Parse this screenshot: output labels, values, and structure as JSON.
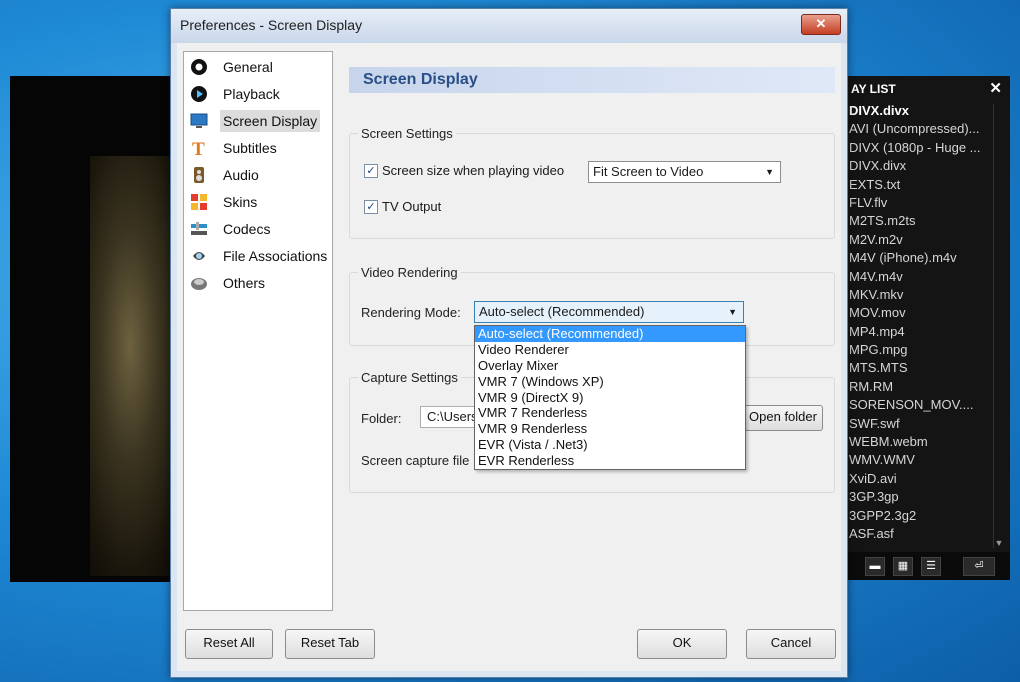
{
  "window": {
    "title": "Preferences - Screen Display",
    "close_glyph": "✕"
  },
  "nav": {
    "items": [
      {
        "label": "General",
        "icon": "general-icon"
      },
      {
        "label": "Playback",
        "icon": "playback-icon"
      },
      {
        "label": "Screen Display",
        "icon": "monitor-icon",
        "selected": true
      },
      {
        "label": "Subtitles",
        "icon": "text-t-icon"
      },
      {
        "label": "Audio",
        "icon": "speaker-icon"
      },
      {
        "label": "Skins",
        "icon": "skins-icon"
      },
      {
        "label": "Codecs",
        "icon": "codecs-icon"
      },
      {
        "label": "File Associations",
        "icon": "file-associations-icon"
      },
      {
        "label": "Others",
        "icon": "others-icon"
      }
    ]
  },
  "panel": {
    "title": "Screen Display",
    "screen_settings": {
      "title": "Screen Settings",
      "screen_size_checkbox": {
        "label": "Screen size when playing video",
        "checked": true
      },
      "screen_size_select": "Fit Screen to Video",
      "tv_output_checkbox": {
        "label": "TV Output",
        "checked": true
      }
    },
    "video_rendering": {
      "title": "Video Rendering",
      "mode_label": "Rendering Mode:",
      "mode_value": "Auto-select (Recommended)",
      "options": [
        "Auto-select (Recommended)",
        "Video Renderer",
        "Overlay Mixer",
        "VMR 7 (Windows XP)",
        "VMR 9 (DirectX 9)",
        "VMR 7 Renderless",
        "VMR 9 Renderless",
        "EVR (Vista / .Net3)",
        "EVR Renderless"
      ]
    },
    "capture_settings": {
      "title": "Capture Settings",
      "folder_label": "Folder:",
      "folder_value": "C:\\Users",
      "open_folder_button": "Open folder",
      "capture_file_label": "Screen capture file"
    }
  },
  "buttons": {
    "reset_all": "Reset All",
    "reset_tab": "Reset Tab",
    "ok": "OK",
    "cancel": "Cancel"
  },
  "playlist": {
    "title": "AY LIST",
    "close_glyph": "✕",
    "items": [
      "DIVX.divx",
      "AVI (Uncompressed)...",
      "DIVX (1080p - Huge ...",
      "DIVX.divx",
      "EXTS.txt",
      "FLV.flv",
      "M2TS.m2ts",
      "M2V.m2v",
      "M4V (iPhone).m4v",
      "M4V.m4v",
      "MKV.mkv",
      "MOV.mov",
      "MP4.mp4",
      "MPG.mpg",
      "MTS.MTS",
      "RM.RM",
      "SORENSON_MOV....",
      "SWF.swf",
      "WEBM.webm",
      "WMV.WMV",
      "XviD.avi",
      "3GP.3gp",
      "3GPP2.3g2",
      "ASF.asf"
    ],
    "toolbar": {
      "minus": "▬",
      "grid": "▦",
      "list": "☰",
      "enter": "⏎"
    }
  }
}
